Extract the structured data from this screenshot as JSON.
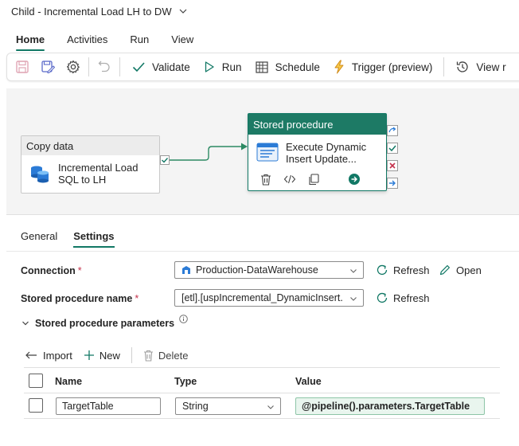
{
  "window": {
    "title": "Child - Incremental Load LH to DW"
  },
  "menu": {
    "tabs": [
      "Home",
      "Activities",
      "Run",
      "View"
    ],
    "active": "Home"
  },
  "toolbar": {
    "validate": "Validate",
    "run": "Run",
    "schedule": "Schedule",
    "trigger": "Trigger (preview)",
    "view_run_history": "View r"
  },
  "canvas": {
    "copy_activity": {
      "header": "Copy data",
      "name": "Incremental Load SQL to LH"
    },
    "sp_activity": {
      "header": "Stored procedure",
      "name_line1": "Execute Dynamic",
      "name_line2": "Insert Update..."
    }
  },
  "properties": {
    "tabs": [
      "General",
      "Settings"
    ],
    "active_tab": "Settings",
    "connection_label": "Connection",
    "connection_value": "Production-DataWarehouse",
    "refresh": "Refresh",
    "open": "Open",
    "sp_name_label": "Stored procedure name",
    "sp_name_value": "[etl].[uspIncremental_DynamicInsert...",
    "params_label": "Stored procedure parameters",
    "import": "Import",
    "new": "New",
    "delete": "Delete",
    "columns": [
      "Name",
      "Type",
      "Value"
    ],
    "rows": [
      {
        "name": "TargetTable",
        "type": "String",
        "value": "@pipeline().parameters.TargetTable"
      }
    ]
  },
  "colors": {
    "accent": "#117865",
    "sp_header": "#1d7a65",
    "required": "#c4314b",
    "expression_bg": "#e9f5ee"
  }
}
